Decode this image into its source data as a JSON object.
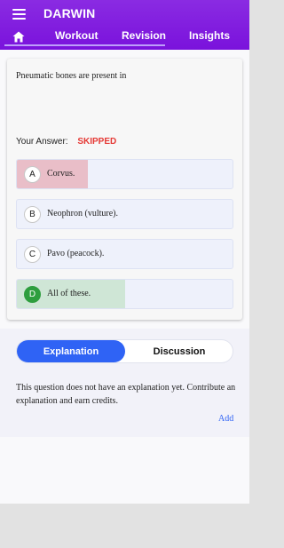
{
  "header": {
    "brand": "DARWIN",
    "tabs": [
      {
        "label": "Workout"
      },
      {
        "label": "Revision"
      },
      {
        "label": "Insights"
      }
    ]
  },
  "question": {
    "text": "Pneumatic bones are present in",
    "answer_label": "Your Answer:",
    "answer_value": "SKIPPED",
    "options": [
      {
        "letter": "A",
        "text": "Corvus.",
        "state": "selected",
        "fill": 0.33,
        "color": "#e9bec8"
      },
      {
        "letter": "B",
        "text": "Neophron (vulture).",
        "state": "none"
      },
      {
        "letter": "C",
        "text": "Pavo (peacock).",
        "state": "none"
      },
      {
        "letter": "D",
        "text": "All of these.",
        "state": "correct",
        "fill": 0.5,
        "color": "#cfe6d6",
        "badge_color": "#2e9e3e"
      }
    ]
  },
  "explanation": {
    "tabs": {
      "explanation": "Explanation",
      "discussion": "Discussion"
    },
    "text": "This question does not have an explanation yet. Contribute an explanation and earn credits.",
    "add_label": "Add"
  },
  "colors": {
    "header": "#7a12dc",
    "accent": "#2f63f5",
    "skipped": "#e53935"
  }
}
